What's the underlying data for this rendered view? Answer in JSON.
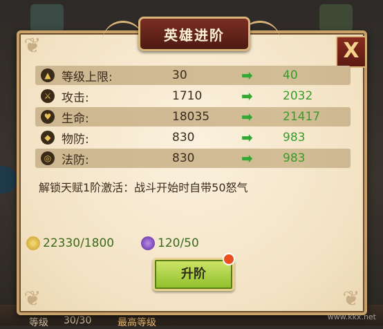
{
  "title": "英雄进阶",
  "close_symbol": "X",
  "stats": [
    {
      "icon": "level-up-icon",
      "label": "等级上限:",
      "current": "30",
      "next": "40"
    },
    {
      "icon": "sword-icon",
      "label": "攻击:",
      "current": "1710",
      "next": "2032"
    },
    {
      "icon": "heart-icon",
      "label": "生命:",
      "current": "18035",
      "next": "21417"
    },
    {
      "icon": "shield-icon",
      "label": "物防:",
      "current": "830",
      "next": "983"
    },
    {
      "icon": "magic-ring-icon",
      "label": "法防:",
      "current": "830",
      "next": "983"
    }
  ],
  "arrow_symbol": "➡",
  "unlock_text": "解锁天赋1阶激活：战斗开始时自带50怒气",
  "resources": {
    "gold": "22330/1800",
    "orb": "120/50"
  },
  "upgrade_label": "升阶",
  "background": {
    "level_label": "等级",
    "level_value": "30/30",
    "max_level": "最高等级"
  },
  "watermark": "www.kkx.net"
}
